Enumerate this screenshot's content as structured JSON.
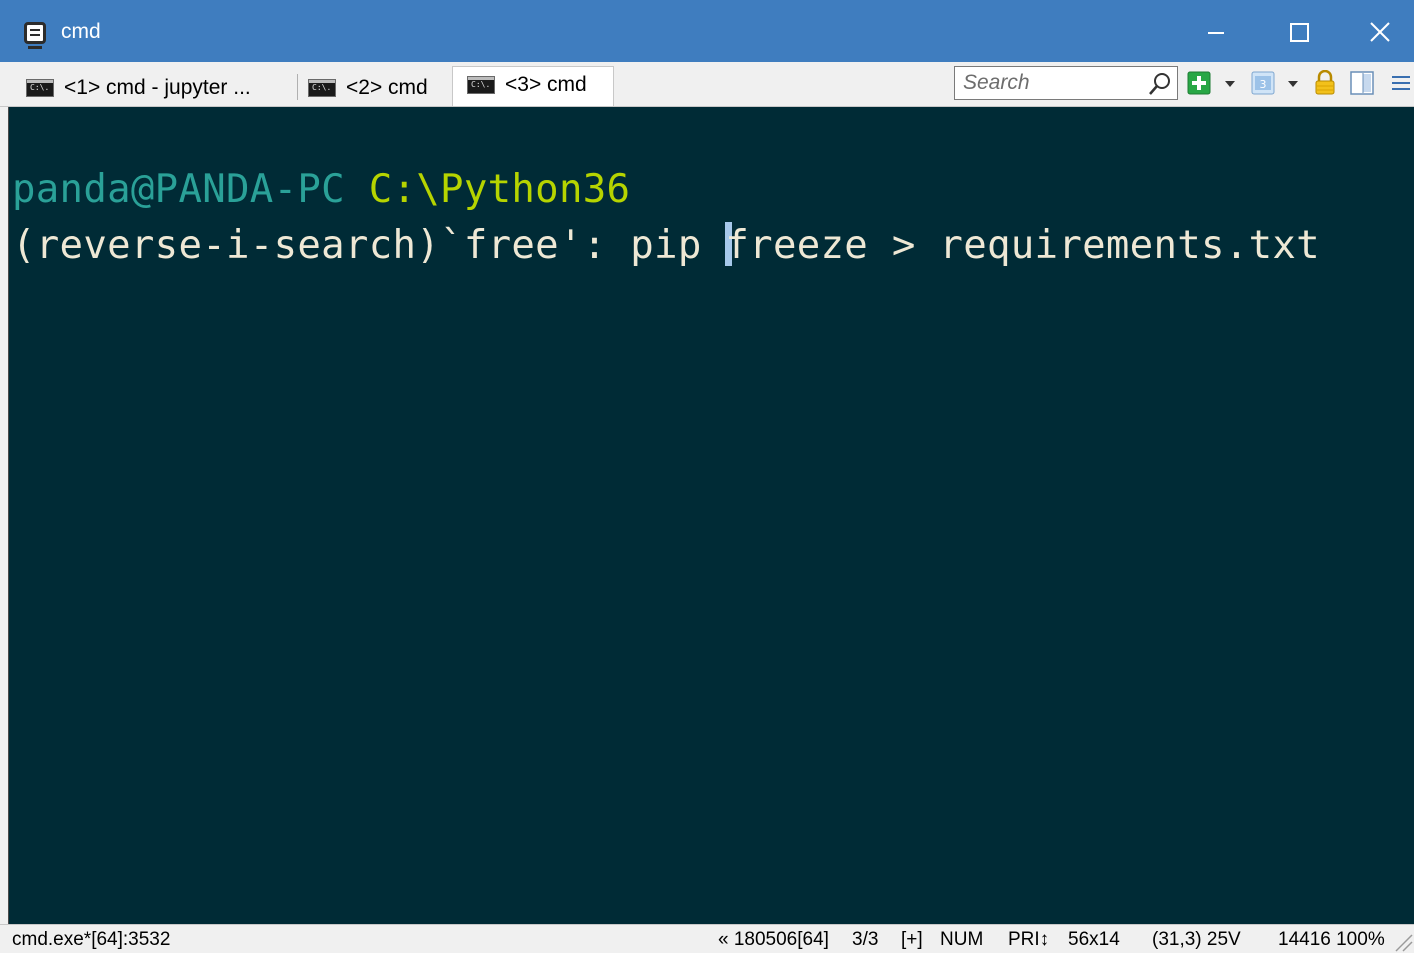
{
  "window": {
    "title": "cmd",
    "minimize_label": "–",
    "maximize_label": "☐",
    "close_label": "✕"
  },
  "tabs": [
    {
      "label": "<1> cmd - jupyter  ...",
      "icon": "console-icon"
    },
    {
      "label": "<2> cmd",
      "icon": "console-icon"
    },
    {
      "label": "<3> cmd",
      "icon": "console-icon",
      "active": true
    }
  ],
  "toolbar": {
    "search_placeholder": "Search",
    "icons": [
      "search-icon",
      "new-console-icon",
      "dropdown-arrow-icon",
      "view-icon",
      "dropdown-arrow-icon",
      "lock-icon",
      "split-panel-icon",
      "menu-icon"
    ]
  },
  "terminal": {
    "prompt_user": "panda@PANDA-PC",
    "prompt_path": "C:\\Python36",
    "search_prefix": "(reverse-i-search)`free': pip ",
    "search_rest": "freeze > requirements.txt",
    "colors": {
      "background": "#002b36",
      "user": "#2aa198",
      "path": "#b6d400",
      "text": "#eee8d5"
    }
  },
  "status": {
    "process": "cmd.exe*[64]:3532",
    "timestamp": "« 180506[64]",
    "tabs": "3/3",
    "flag": "[+]",
    "num": "NUM",
    "pri": "PRI↕",
    "size": "56x14",
    "pos": "(31,3) 25V",
    "mem": "14416 100%"
  }
}
